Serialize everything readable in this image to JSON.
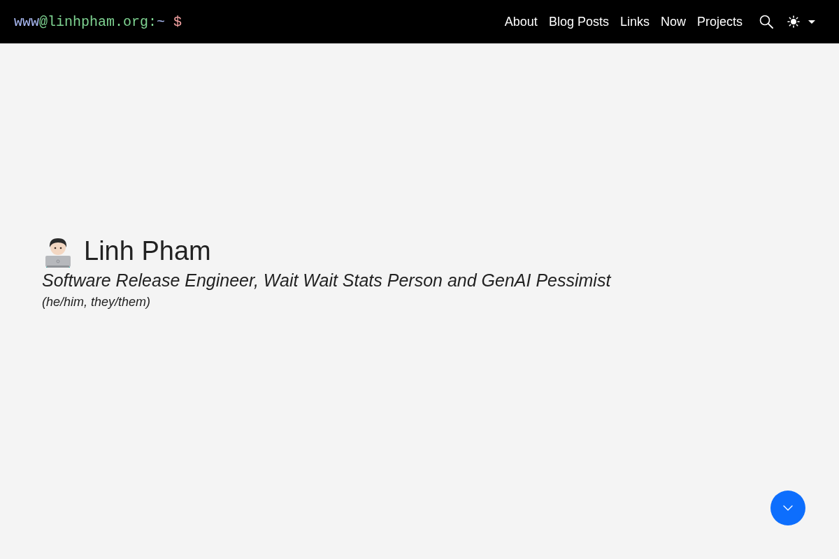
{
  "header": {
    "prompt": {
      "segments": [
        {
          "text": "www",
          "color": "#a9b9f2"
        },
        {
          "text": "@linhpham.org:",
          "color": "#7fd492"
        },
        {
          "text": "~",
          "color": "#a9b9f2"
        }
      ],
      "symbol": "$"
    },
    "nav": [
      {
        "label": "About"
      },
      {
        "label": "Blog Posts"
      },
      {
        "label": "Links"
      },
      {
        "label": "Now"
      },
      {
        "label": "Projects"
      }
    ]
  },
  "hero": {
    "name": "Linh Pham",
    "tagline": "Software Release Engineer, Wait Wait Stats Person and GenAI Pessimist",
    "pronouns": "(he/him, they/them)"
  }
}
